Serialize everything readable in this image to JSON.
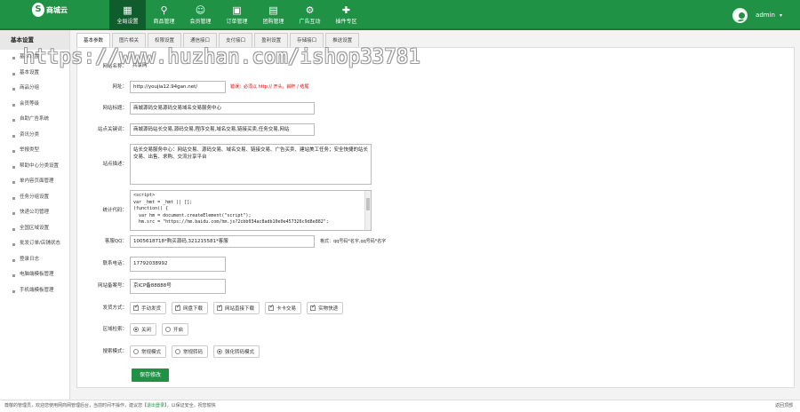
{
  "brand": {
    "logo_text": "商城云",
    "logo_mark": "S"
  },
  "nav": [
    {
      "label": "全局设置",
      "icon": "grid-icon",
      "glyph": "▦",
      "active": true
    },
    {
      "label": "商品管理",
      "icon": "user-icon",
      "glyph": "⚲",
      "active": false
    },
    {
      "label": "会员管理",
      "icon": "users-icon",
      "glyph": "☺",
      "active": false
    },
    {
      "label": "订单管理",
      "icon": "camera-icon",
      "glyph": "▣",
      "active": false
    },
    {
      "label": "团购管理",
      "icon": "calendar-icon",
      "glyph": "▤",
      "active": false
    },
    {
      "label": "广告互动",
      "icon": "gear-icon",
      "glyph": "⚙",
      "active": false
    },
    {
      "label": "插件专区",
      "icon": "gift-icon",
      "glyph": "✚",
      "active": false
    }
  ],
  "user": {
    "name": "admin",
    "caret": "▾"
  },
  "sidebar": {
    "title": "基本设置",
    "items": [
      "基本设置",
      "基本设置",
      "商品分组",
      "会员等级",
      "自助广告系统",
      "资讯分类",
      "举报类型",
      "帮助中心分类设置",
      "单内容页面管理",
      "任务分组设置",
      "快递公司管理",
      "全国区域设置",
      "批发订单/店铺状态",
      "登录日志",
      "电脑端模板管理",
      "手机端模板管理"
    ]
  },
  "tabs": [
    "基本参数",
    "图片相关",
    "权限设置",
    "通信接口",
    "支付接口",
    "盈利设置",
    "存储接口",
    "推送设置"
  ],
  "form": {
    "site_name": {
      "label": "网站名称：",
      "value": "共享网"
    },
    "url": {
      "label": "网址：",
      "value": "http://youjia12.94gan.net/",
      "hint": "错误：必须以 http:// 开头，斜杆 / 结尾"
    },
    "title": {
      "label": "网站标题：",
      "value": "商城源码交易源码交易域名交易服务中心"
    },
    "keywords": {
      "label": "站点关键词：",
      "value": "商城源码站长交易,源码交易,程序交易,域名交易,链接买卖,任务交易,网站"
    },
    "description": {
      "label": "站点描述：",
      "value": "站长交易服务中心：网站交易、源码交易、域名交易、链接交易、广告买卖、建站美工任务；安全快捷的站长交易、出售、求购、交流分享平台"
    },
    "stats": {
      "label": "统计代码：",
      "value": "<script>\nvar _hmt = _hmt || [];\n(function() {\n  var hm = document.createElement(\"script\");\n  hm.src = \"https://hm.baidu.com/hm.js?2cbb034ac8adb10e0e457326c9d8e882\";"
    },
    "qq": {
      "label": "客服QQ：",
      "value": "1005618718*购买源码,321215581*客服",
      "hint": "格式：qq号码*名字,qq号码*名字"
    },
    "phone": {
      "label": "联系电话：",
      "value": "17792038992"
    },
    "icp": {
      "label": "网站备案号：",
      "value": "京ICP备88888号"
    },
    "delivery": {
      "label": "发货方式：",
      "options": [
        {
          "text": "手动发货",
          "checked": true
        },
        {
          "text": "网盘下载",
          "checked": true
        },
        {
          "text": "网站直接下载",
          "checked": true
        },
        {
          "text": "卡卡交易",
          "checked": true
        },
        {
          "text": "实物快递",
          "checked": true
        }
      ]
    },
    "region": {
      "label": "区域检索：",
      "options": [
        {
          "text": "关闭",
          "selected": true
        },
        {
          "text": "开启",
          "selected": false
        }
      ]
    },
    "search_mode": {
      "label": "搜索模式：",
      "options": [
        {
          "text": "常规模式",
          "selected": false
        },
        {
          "text": "常规转码",
          "selected": false
        },
        {
          "text": "强化转码模式",
          "selected": true
        }
      ]
    },
    "save_label": "保存修改"
  },
  "footer": {
    "text": "尊敬的管理员，欢迎您使用网商网管理后台，当前时间不操作，建议您",
    "link": "退出登录",
    "text2": "，以保证安全。祝您愉快",
    "right": "返回顶部"
  },
  "watermark": "https://www.huzhan.com/ishop33781",
  "colors": {
    "primary": "#1f9246",
    "hint_red": "#e00000"
  }
}
